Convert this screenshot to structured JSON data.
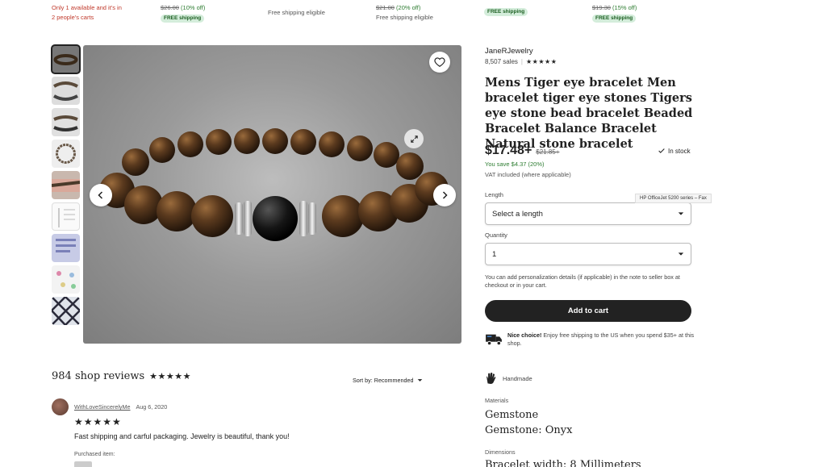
{
  "top_strip": {
    "item1_line1": "Only 1 available and it's in",
    "item1_line2": "2 people's carts",
    "item2_price": "$26.00",
    "item2_off": " (10% off)",
    "item2_badge": "FREE shipping",
    "item3_text": "Free shipping eligible",
    "item4_price": "$21.00",
    "item4_off": " (20% off)",
    "item4_text": "Free shipping eligible",
    "item5_badge": "FREE shipping",
    "item6_price": "$19.30",
    "item6_off": " (15% off)",
    "item6_badge": "FREE shipping"
  },
  "shop": {
    "name": "JaneRJewelry",
    "sales": "8,507 sales",
    "rating_stars": "★★★★★"
  },
  "product": {
    "title": "Mens Tiger eye bracelet Men bracelet tiger eye stones Tigers eye stone bead bracelet Beaded Bracelet Balance Bracelet Natural stone bracelet",
    "price": "$17.48+",
    "old_price": "$21.85+",
    "stock": "In stock",
    "save": "You save $4.37 (20%)",
    "vat": "VAT included (where applicable)"
  },
  "options": {
    "length_label": "Length",
    "length_value": "Select a length",
    "quantity_label": "Quantity",
    "quantity_value": "1",
    "tooltip": "HP OfficeJet 5200 series – Fax"
  },
  "note": "You can add personalization details (if applicable) in the note to seller box at checkout or in your cart.",
  "add_to_cart": "Add to cart",
  "shipping": {
    "bold": "Nice choice!",
    "text": " Enjoy free shipping to the US when you spend $35+ at this shop."
  },
  "details": {
    "handmade": "Handmade",
    "materials_label": "Materials",
    "material1": "Gemstone",
    "material2": "Gemstone: Onyx",
    "dimensions_label": "Dimensions",
    "dimension1": "Bracelet width: 8 Millimeters"
  },
  "reviews": {
    "title": "984 shop reviews",
    "stars": "★★★★★",
    "sort_label": "Sort by: Recommended",
    "reviewer": "WithLoveSincerelyMe",
    "date": "Aug 6, 2020",
    "review_stars": "★★★★★",
    "text": "Fast shipping and carful packaging. Jewelry is beautiful, thank you!",
    "purchased": "Purchased item:"
  },
  "colors": {
    "accent_dark": "#222222",
    "save_green": "#2e7d32",
    "badge_green": "#d4eddb"
  },
  "icons": [
    "heart-icon",
    "expand-icon",
    "chevron-left-icon",
    "chevron-right-icon",
    "check-icon",
    "chevron-down-icon",
    "truck-icon",
    "hand-icon",
    "star-icon"
  ]
}
